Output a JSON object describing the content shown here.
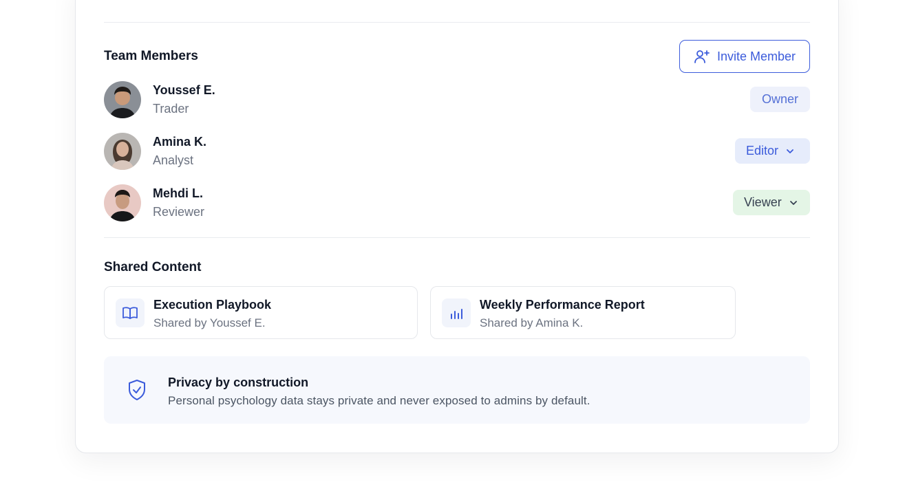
{
  "team": {
    "title": "Team Members",
    "invite_label": "Invite Member",
    "members": [
      {
        "name": "Youssef E.",
        "role": "Trader",
        "permission": "Owner"
      },
      {
        "name": "Amina K.",
        "role": "Analyst",
        "permission": "Editor"
      },
      {
        "name": "Mehdi L.",
        "role": "Reviewer",
        "permission": "Viewer"
      }
    ]
  },
  "shared": {
    "title": "Shared Content",
    "items": [
      {
        "title": "Execution Playbook",
        "subtitle": "Shared by Youssef E.",
        "icon": "book-open-icon"
      },
      {
        "title": "Weekly Performance Report",
        "subtitle": "Shared by Amina K.",
        "icon": "bar-chart-icon"
      }
    ]
  },
  "privacy": {
    "title": "Privacy by construction",
    "text": "Personal psychology data stays private and never exposed to admins by default.",
    "icon": "shield-check-icon"
  },
  "colors": {
    "accent": "#3b5bdb",
    "owner_bg": "#eef1fb",
    "editor_bg": "#e6ecfb",
    "viewer_bg": "#e4f5e6",
    "privacy_bg": "#f6f8fd"
  }
}
